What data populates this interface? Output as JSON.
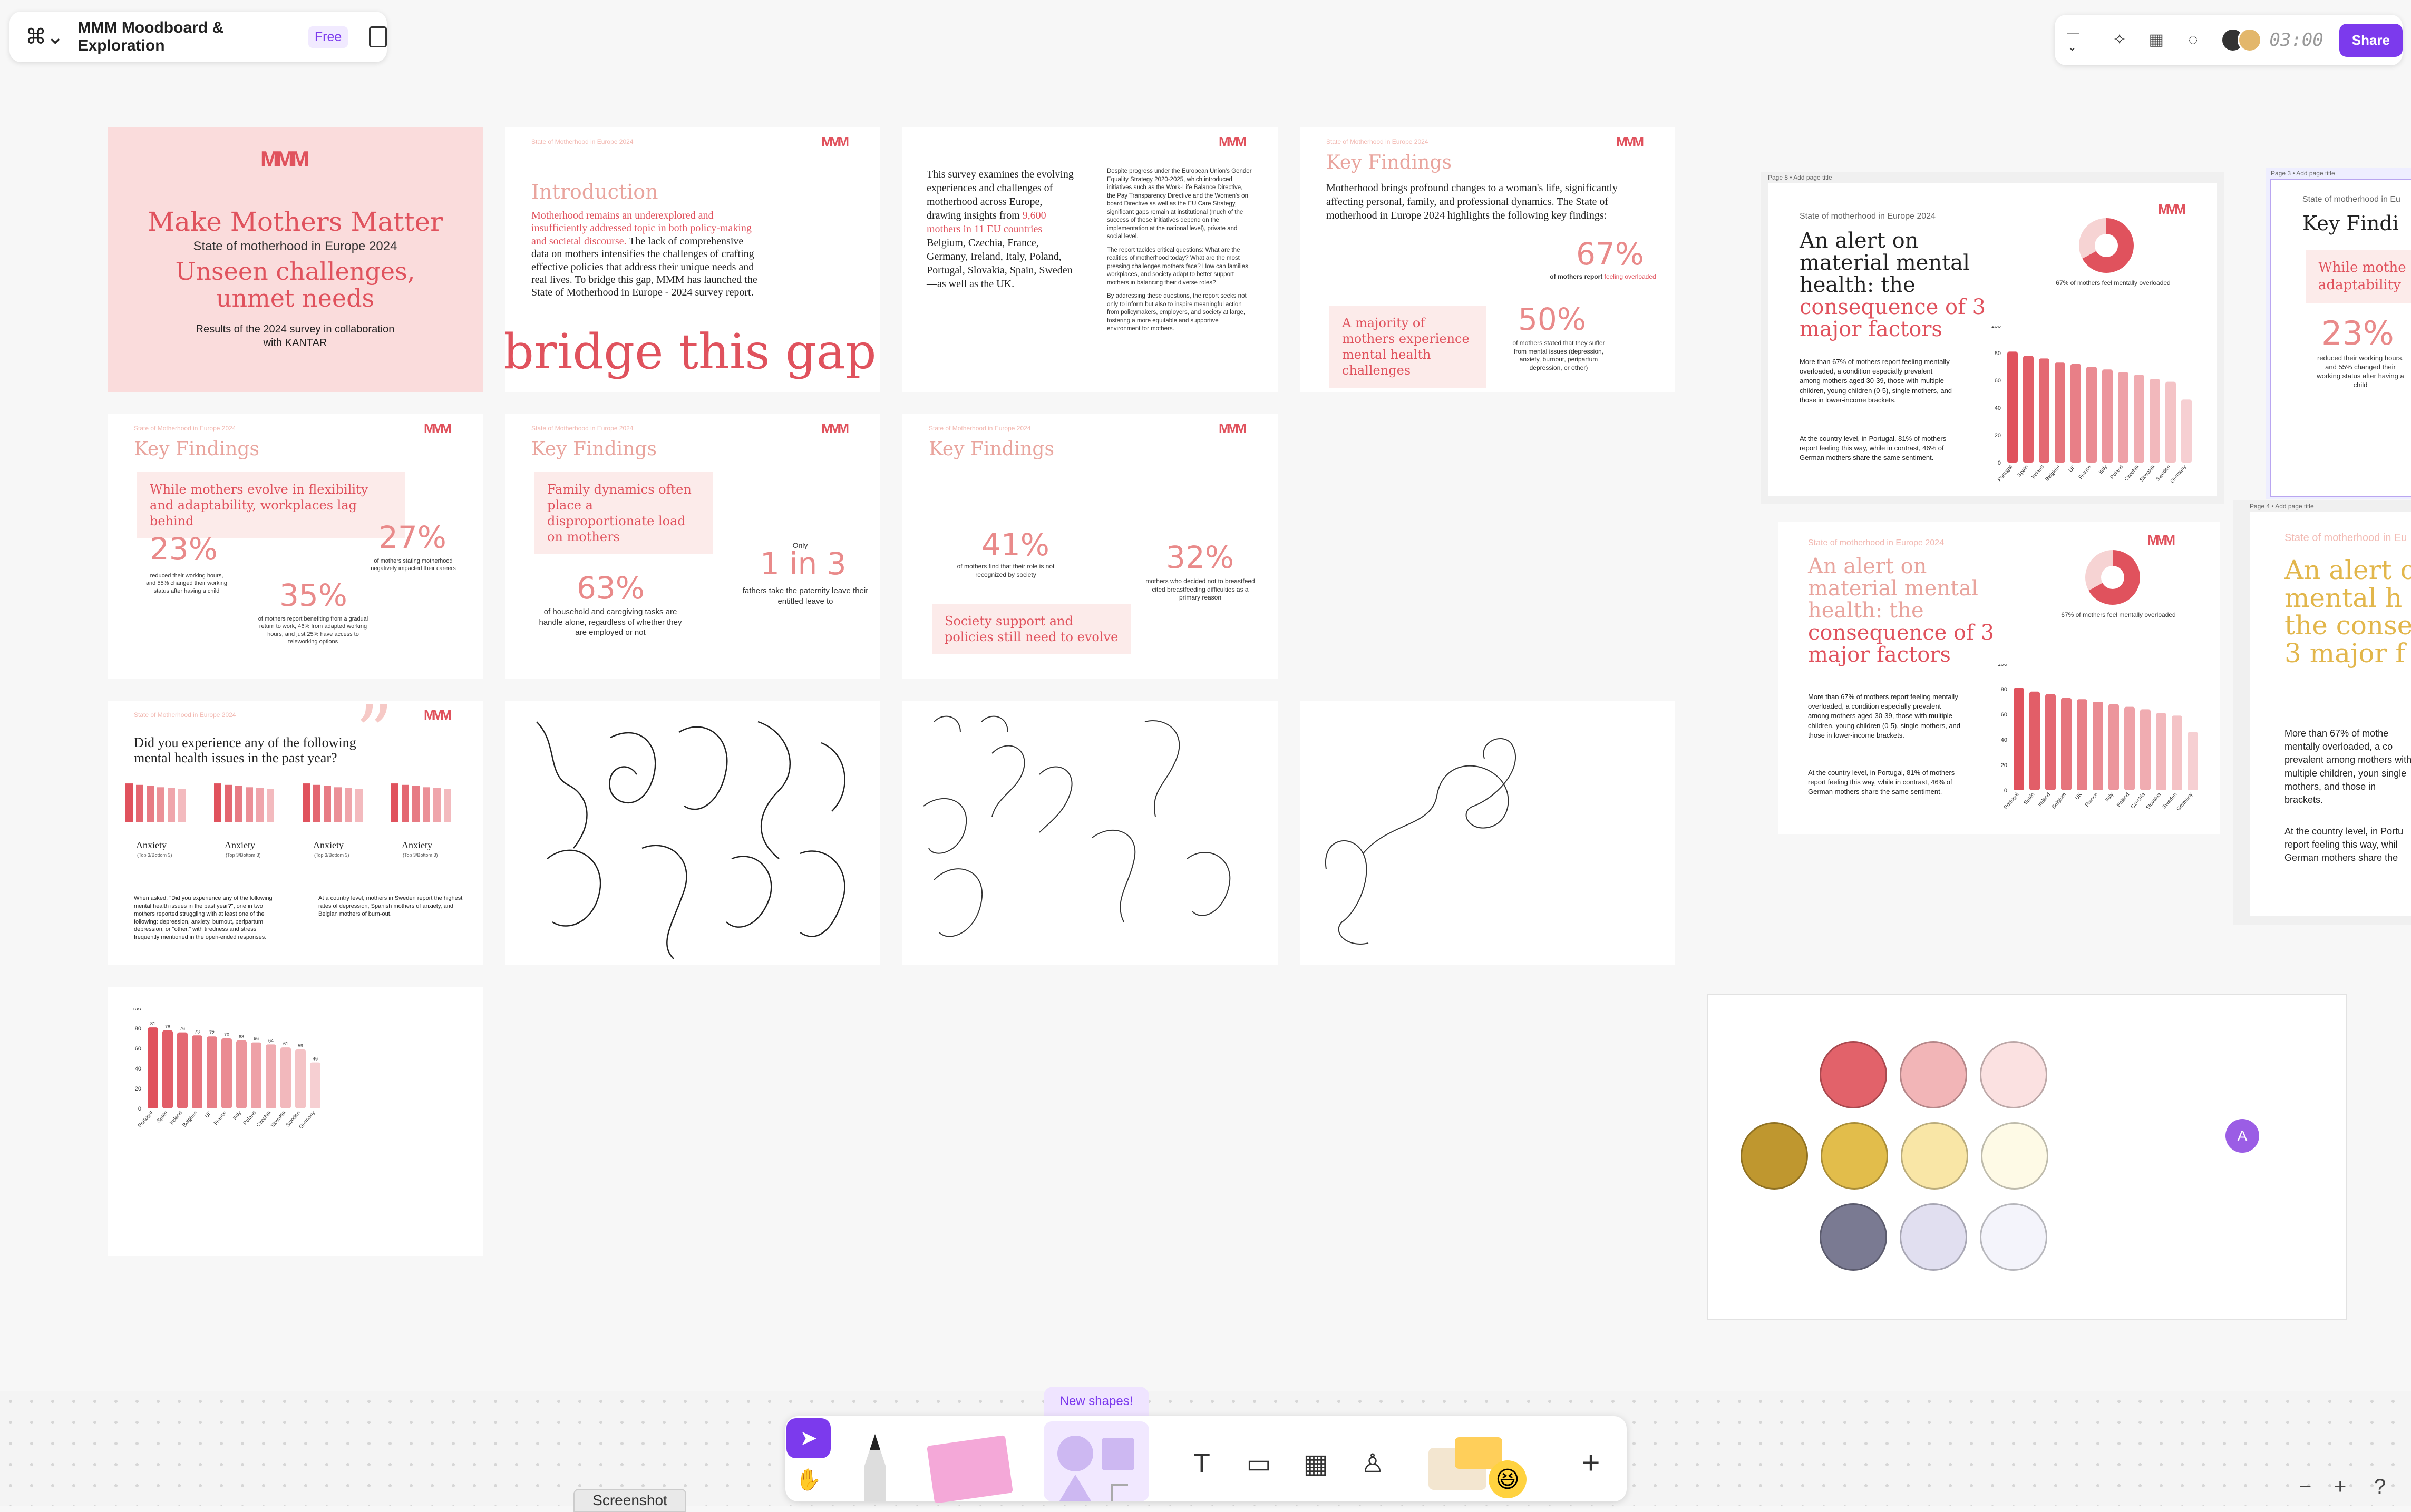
{
  "file": {
    "title": "MMM Moodboard & Exploration",
    "plan": "Free"
  },
  "toolbar_right": {
    "zoom": "—",
    "timer": "03:00",
    "share": "Share"
  },
  "cover": {
    "brand": "Make Mothers Matter",
    "subtitle": "State of motherhood in Europe 2024",
    "headline": "Unseen challenges, unmet needs",
    "results": "Results of the 2024 survey in collaboration with KANTAR"
  },
  "intro": {
    "kicker": "State of Motherhood in Europe 2024",
    "heading": "Introduction",
    "lead_red": "Motherhood remains an underexplored and insufficiently addressed topic in both policy-making and societal discourse.",
    "body": "The lack of comprehensive data on mothers intensifies the challenges of crafting effective policies that address their unique needs and real lives. To bridge this gap, MMM has launched the State of Motherhood in Europe - 2024 survey report.",
    "big": "bridge this gap"
  },
  "survey": {
    "left_a": "This survey examines the evolving experiences and challenges of motherhood across Europe, drawing insights from ",
    "left_red": "9,600 mothers in 11 EU countries",
    "left_b": "—Belgium, Czechia, France, Germany, Ireland, Italy, Poland, Portugal, Slovakia, Spain, Sweden—as well as the UK.",
    "right_1": "Despite progress under the European Union's Gender Equality Strategy 2020-2025, which introduced initiatives such as the Work-Life Balance Directive, the Pay Transparency Directive and the Women's on board Directive as well as the EU Care Strategy, significant gaps remain at institutional (much of the success of these initiatives depend on the implementation at the national level), private and social level.",
    "right_2": "The report tackles critical questions: What are the realities of motherhood today? What are the most pressing challenges mothers face? How can families, workplaces, and society adapt to better support mothers in balancing their diverse roles?",
    "right_3": "By addressing these questions, the report seeks not only to inform but also to inspire meaningful action from policymakers, employers, and society at large, fostering a more equitable and supportive environment for mothers."
  },
  "kf1": {
    "kicker": "State of Motherhood in Europe 2024",
    "heading": "Key Findings",
    "body": "Motherhood brings profound changes to a woman's life, significantly affecting personal, family, and professional dynamics. The State of motherhood in Europe 2024 highlights the following key findings:",
    "box": "A majority of mothers experience mental health challenges",
    "stat1": "67%",
    "stat1_cap_a": "of mothers report ",
    "stat1_cap_red": "feeling overloaded",
    "stat2": "50%",
    "stat2_cap": "of mothers stated that they suffer from mental issues (depression, anxiety, burnout, peripartum depression, or other)"
  },
  "kf2": {
    "kicker": "State of Motherhood in Europe 2024",
    "heading": "Key Findings",
    "box": "While mothers evolve in flexibility and adaptability, workplaces lag behind",
    "s1": "23%",
    "s1_cap": "reduced their working hours, and 55% changed their working status after having a child",
    "s2": "27%",
    "s2_cap": "of mothers stating motherhood negatively impacted their careers",
    "s3": "35%",
    "s3_cap": "of mothers report benefiting from a gradual return to work, 46% from adapted working hours, and just 25% have access to teleworking options"
  },
  "kf3": {
    "kicker": "State of Motherhood in Europe 2024",
    "heading": "Key Findings",
    "box": "Family dynamics often place a disproportionate load on mothers",
    "s1": "63%",
    "s1_cap": "of household and caregiving tasks are handle alone, regardless of whether they are employed or not",
    "only": "Only",
    "s2": "1 in 3",
    "s2_cap": "fathers take the paternity leave their entitled leave to"
  },
  "kf4": {
    "kicker": "State of Motherhood in Europe 2024",
    "heading": "Key Findings",
    "s1": "41%",
    "s1_cap": "of mothers find that their role is not recognized by society",
    "s2": "32%",
    "s2_cap": "mothers who decided not to breastfeed cited breastfeeding difficulties as a primary reason",
    "box": "Society support and policies still need to evolve"
  },
  "mh": {
    "kicker": "State of Motherhood in Europe 2024",
    "question": "Did you experience any of the following mental health issues in the past year?",
    "labels": [
      "Anxiety",
      "Anxiety",
      "Anxiety",
      "Anxiety"
    ],
    "sublabels": [
      "(Top 3/Bottom 3)",
      "(Top 3/Bottom 3)",
      "(Top 3/Bottom 3)",
      "(Top 3/Bottom 3)"
    ],
    "text_left": "When asked, \"Did you experience any of the following mental health issues in the past year?\", one in two mothers reported struggling with at least one of the following: depression, anxiety, burnout, peripartum depression, or \"other,\" with tiredness and stress frequently mentioned in the open-ended responses.",
    "text_right": "At a country level, mothers in Sweden report the highest rates of depression, Spanish mothers of anxiety, and Belgian mothers of burn-out."
  },
  "alert": {
    "page_label": "Page 8 • Add page title",
    "kicker": "State of motherhood in Europe 2024",
    "title_a": "An alert on material mental health: the ",
    "title_red": "consequence of 3 major factors",
    "donut_cap": "67% of mothers feel mentally overloaded",
    "p1": "More than 67% of mothers report feeling mentally overloaded, a condition especially prevalent among mothers aged 30-39, those with multiple children, young children (0-5), single mothers, and those in lower-income brackets.",
    "p2": "At the country level, in Portugal, 81% of mothers report feeling this way, while in contrast, 46% of German mothers share the same sentiment."
  },
  "alert2": {
    "kicker": "State of motherhood in Europe 2024",
    "title_a": "An alert on material mental health: the ",
    "title_red": "consequence of 3 major factors",
    "donut_cap": "67% of mothers feel mentally overloaded",
    "p1": "More than 67% of mothers report feeling mentally overloaded, a condition especially prevalent among mothers aged 30-39, those with multiple children, young children (0-5), single mothers, and those in lower-income brackets.",
    "p2": "At the country level, in Portugal, 81% of mothers report feeling this way, while in contrast, 46% of German mothers share the same sentiment."
  },
  "partial1": {
    "page_label": "Page 3 • Add page title",
    "kicker": "State of motherhood in Eu",
    "heading": "Key Findi",
    "box": "While mothe adaptability",
    "stat": "23%",
    "cap": "reduced their working hours, and 55% changed their working status after having a child"
  },
  "partial2": {
    "page_label": "Page 4 • Add page title",
    "kicker": "State of motherhood in Eu",
    "title": "An alert o mental h the conse 3 major f",
    "p1": "More than 67% of mothe mentally overloaded, a co prevalent among mothers with multiple children, youn single mothers, and those in brackets.",
    "p2": "At the country level, in Portu report feeling this way, whil German mothers share the"
  },
  "chart_data": {
    "type": "bar",
    "x": [
      "Portugal",
      "Spain",
      "Ireland",
      "Belgium",
      "UK",
      "France",
      "Italy",
      "Poland",
      "Czechia",
      "Slovakia",
      "Sweden",
      "Germany"
    ],
    "values": [
      81,
      78,
      76,
      73,
      72,
      70,
      68,
      66,
      64,
      61,
      59,
      46
    ],
    "ylim": [
      0,
      100
    ],
    "yticks": [
      "0",
      "20",
      "40",
      "60",
      "80",
      "100"
    ]
  },
  "swatches": {
    "rows": [
      [
        "#e2626a",
        "#f2b5b7",
        "#fbe1e1"
      ],
      [
        "#bf972f",
        "#e2bd4b",
        "#f9e6a6",
        "#fefae6"
      ],
      [
        "#7a7a92",
        "#e1dff0",
        "#f4f4fb"
      ]
    ],
    "avatar_letter": "A"
  },
  "bottom": {
    "new_shapes": "New shapes!",
    "screenshot": "Screenshot",
    "zoom_out": "−",
    "zoom_in": "+",
    "help": "?"
  }
}
